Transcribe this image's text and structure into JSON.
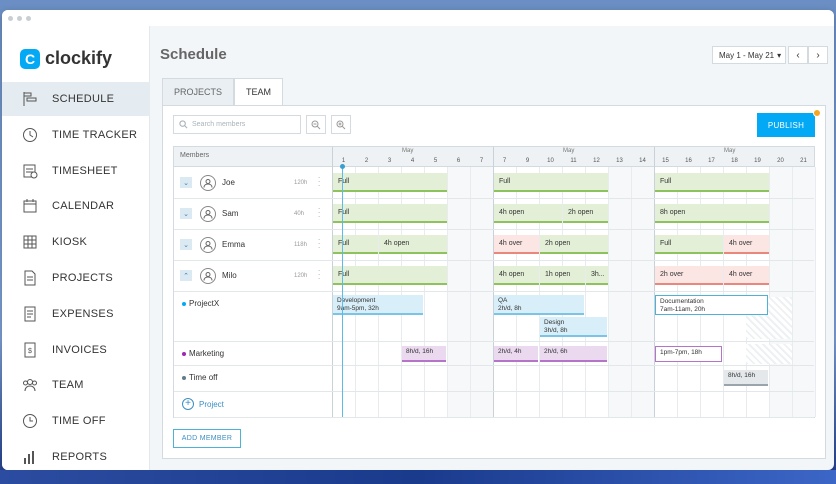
{
  "app": {
    "logo_text": "clockify",
    "brand_color": "#03a9f4"
  },
  "sidebar": {
    "items": [
      {
        "label": "SCHEDULE",
        "icon": "schedule-icon",
        "active": true
      },
      {
        "label": "TIME TRACKER",
        "icon": "clock-icon"
      },
      {
        "label": "TIMESHEET",
        "icon": "timesheet-icon"
      },
      {
        "label": "CALENDAR",
        "icon": "calendar-icon"
      },
      {
        "label": "KIOSK",
        "icon": "kiosk-icon"
      },
      {
        "label": "PROJECTS",
        "icon": "projects-icon"
      },
      {
        "label": "EXPENSES",
        "icon": "expenses-icon"
      },
      {
        "label": "INVOICES",
        "icon": "invoices-icon"
      },
      {
        "label": "TEAM",
        "icon": "team-icon"
      },
      {
        "label": "TIME OFF",
        "icon": "time-off-icon"
      },
      {
        "label": "REPORTS",
        "icon": "reports-icon"
      }
    ]
  },
  "header": {
    "title": "Schedule",
    "date_range": "May 1 - May 21",
    "prev": "‹",
    "next": "›"
  },
  "tabs": [
    {
      "label": "PROJECTS",
      "active": false
    },
    {
      "label": "TEAM",
      "active": true
    }
  ],
  "toolbar": {
    "search_placeholder": "Search members",
    "publish_label": "PUBLISH"
  },
  "grid": {
    "members_header": "Members",
    "month": "May",
    "days": [
      "1",
      "2",
      "3",
      "4",
      "5",
      "6",
      "7",
      "7",
      "9",
      "10",
      "11",
      "12",
      "13",
      "14",
      "15",
      "16",
      "17",
      "18",
      "19",
      "20",
      "21"
    ],
    "weekend_indexes": [
      5,
      6,
      12,
      13,
      19,
      20
    ]
  },
  "members": [
    {
      "name": "Joe",
      "capacity": "120h",
      "expanded": true,
      "bars": [
        {
          "start": 0,
          "span": 5,
          "text": "Full",
          "type": "green"
        },
        {
          "start": 7,
          "span": 5,
          "text": "Full",
          "type": "green"
        },
        {
          "start": 14,
          "span": 5,
          "text": "Full",
          "type": "green"
        }
      ]
    },
    {
      "name": "Sam",
      "capacity": "40h",
      "expanded": true,
      "bars": [
        {
          "start": 0,
          "span": 5,
          "text": "Full",
          "type": "green"
        },
        {
          "start": 7,
          "span": 3,
          "text": "4h open",
          "type": "green"
        },
        {
          "start": 10,
          "span": 2,
          "text": "2h open",
          "type": "green"
        },
        {
          "start": 14,
          "span": 5,
          "text": "8h open",
          "type": "green"
        }
      ]
    },
    {
      "name": "Emma",
      "capacity": "118h",
      "expanded": true,
      "bars": [
        {
          "start": 0,
          "span": 2,
          "text": "Full",
          "type": "green"
        },
        {
          "start": 2,
          "span": 3,
          "text": "4h open",
          "type": "green"
        },
        {
          "start": 7,
          "span": 2,
          "text": "4h over",
          "type": "red"
        },
        {
          "start": 9,
          "span": 3,
          "text": "2h open",
          "type": "green"
        },
        {
          "start": 14,
          "span": 3,
          "text": "Full",
          "type": "green"
        },
        {
          "start": 17,
          "span": 2,
          "text": "4h over",
          "type": "red"
        }
      ]
    },
    {
      "name": "Milo",
      "capacity": "120h",
      "expanded": false,
      "bars": [
        {
          "start": 0,
          "span": 5,
          "text": "Full",
          "type": "green"
        },
        {
          "start": 7,
          "span": 2,
          "text": "4h open",
          "type": "green"
        },
        {
          "start": 9,
          "span": 2,
          "text": "1h open",
          "type": "green"
        },
        {
          "start": 11,
          "span": 1,
          "text": "3h...",
          "type": "green"
        },
        {
          "start": 14,
          "span": 3,
          "text": "2h over",
          "type": "red"
        },
        {
          "start": 17,
          "span": 2,
          "text": "4h over",
          "type": "red"
        }
      ]
    }
  ],
  "projects": [
    {
      "name": "ProjectX",
      "color": "#03a9f4"
    },
    {
      "name": "Marketing",
      "color": "#9c27b0"
    },
    {
      "name": "Time off",
      "color": "#607d8b"
    }
  ],
  "assignments": {
    "development": {
      "title": "Development",
      "detail": "9am-5pm, 32h"
    },
    "qa": {
      "title": "QA",
      "detail": "2h/d, 8h"
    },
    "design": {
      "title": "Design",
      "detail": "3h/d, 8h"
    },
    "documentation": {
      "title": "Documentation",
      "detail": "7am-11am, 20h"
    },
    "mkt1": {
      "detail": "8h/d, 16h"
    },
    "mkt2": {
      "detail": "2h/d, 4h"
    },
    "mkt3": {
      "detail": "2h/d, 6h"
    },
    "mkt4": {
      "detail": "1pm-7pm, 18h"
    },
    "timeoff": {
      "detail": "8h/d, 16h"
    }
  },
  "add_project_label": "Project",
  "add_member_label": "ADD MEMBER"
}
